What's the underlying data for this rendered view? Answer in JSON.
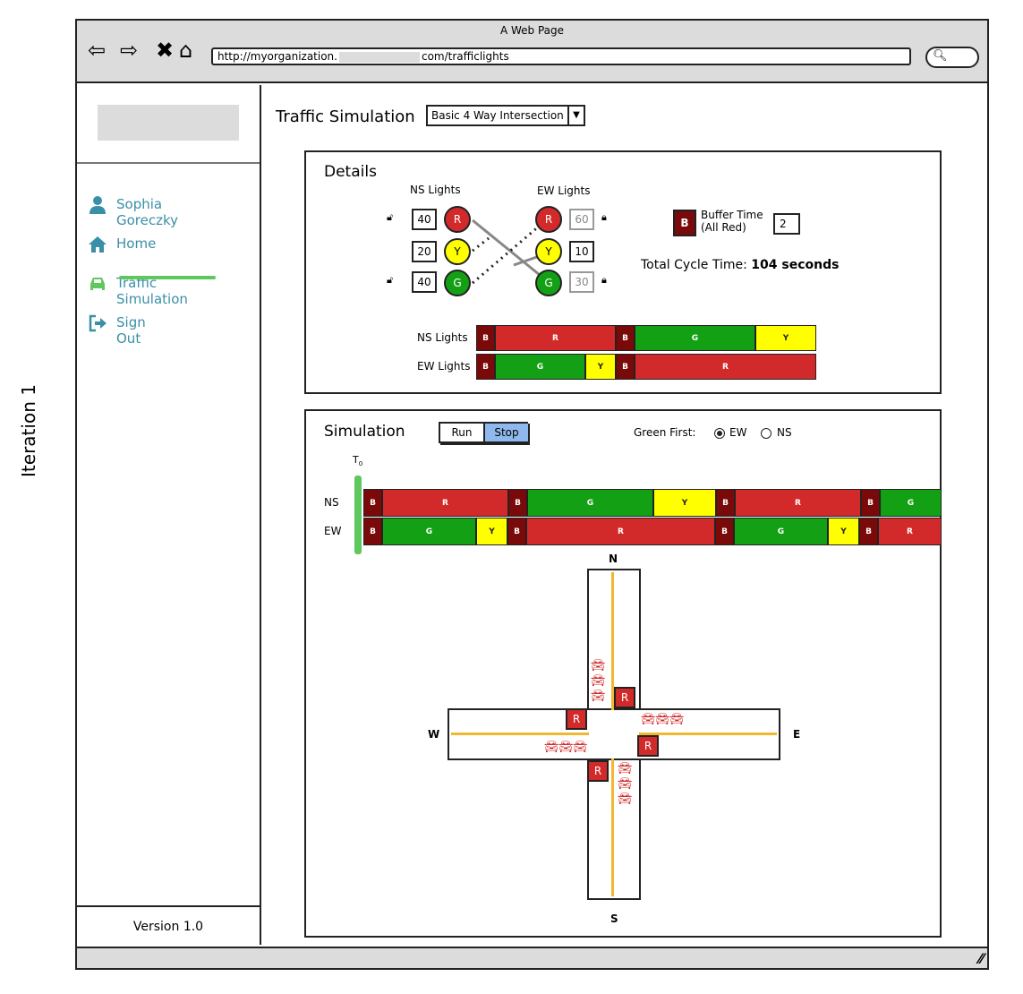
{
  "side_label": "Iteration 1",
  "window": {
    "title": "A Web Page",
    "url_prefix": "http://myorganization.",
    "url_suffix": "com/trafficlights"
  },
  "sidebar": {
    "items": [
      {
        "label": "Sophia Goreczky",
        "icon": "user-icon"
      },
      {
        "label": "Home",
        "icon": "home-icon"
      },
      {
        "label": "Traffic Simulation",
        "icon": "car-icon"
      },
      {
        "label": "Sign Out",
        "icon": "sign-out-icon"
      }
    ],
    "version": "Version 1.0"
  },
  "main": {
    "title": "Traffic Simulation",
    "scenario": "Basic 4 Way Intersection"
  },
  "details": {
    "title": "Details",
    "ns_label": "NS Lights",
    "ew_label": "EW Lights",
    "ns": {
      "red": "40",
      "yellow": "20",
      "green": "40"
    },
    "ew": {
      "red": "60",
      "yellow": "10",
      "green": "30"
    },
    "lamp_letters": {
      "red": "R",
      "yellow": "Y",
      "green": "G"
    },
    "buffer": {
      "letter": "B",
      "label_line1": "Buffer Time",
      "label_line2": "(All Red)",
      "value": "2"
    },
    "total_prefix": "Total Cycle Time: ",
    "total_value": "104 seconds",
    "timeline": {
      "NS Lights": [
        [
          "B",
          2
        ],
        [
          "R",
          40
        ],
        [
          "B",
          2
        ],
        [
          "G",
          40
        ],
        [
          "Y",
          20
        ]
      ],
      "EW Lights": [
        [
          "B",
          2
        ],
        [
          "G",
          30
        ],
        [
          "Y",
          10
        ],
        [
          "B",
          2
        ],
        [
          "R",
          60
        ]
      ]
    }
  },
  "simulation": {
    "title": "Simulation",
    "run": "Run",
    "stop": "Stop",
    "green_first_label": "Green First:",
    "options": [
      "EW",
      "NS"
    ],
    "selected": "EW",
    "t0": "T",
    "t0_sub": "0",
    "row_labels": [
      "NS",
      "EW"
    ],
    "timeline": {
      "NS": [
        [
          "B",
          2
        ],
        [
          "R",
          40
        ],
        [
          "B",
          2
        ],
        [
          "G",
          40
        ],
        [
          "Y",
          20
        ],
        [
          "B",
          2
        ],
        [
          "R",
          40
        ],
        [
          "B",
          2
        ],
        [
          "G",
          20
        ]
      ],
      "EW": [
        [
          "B",
          2
        ],
        [
          "G",
          30
        ],
        [
          "Y",
          10
        ],
        [
          "B",
          2
        ],
        [
          "R",
          60
        ],
        [
          "B",
          2
        ],
        [
          "G",
          30
        ],
        [
          "Y",
          10
        ],
        [
          "B",
          2
        ],
        [
          "R",
          20
        ]
      ]
    },
    "compass": {
      "n": "N",
      "s": "S",
      "e": "E",
      "w": "W"
    },
    "signal_letter": "R"
  },
  "colors": {
    "R": "#d22a2a",
    "G": "#14a014",
    "Y": "#ffff00",
    "B": "#7a0a0a"
  }
}
